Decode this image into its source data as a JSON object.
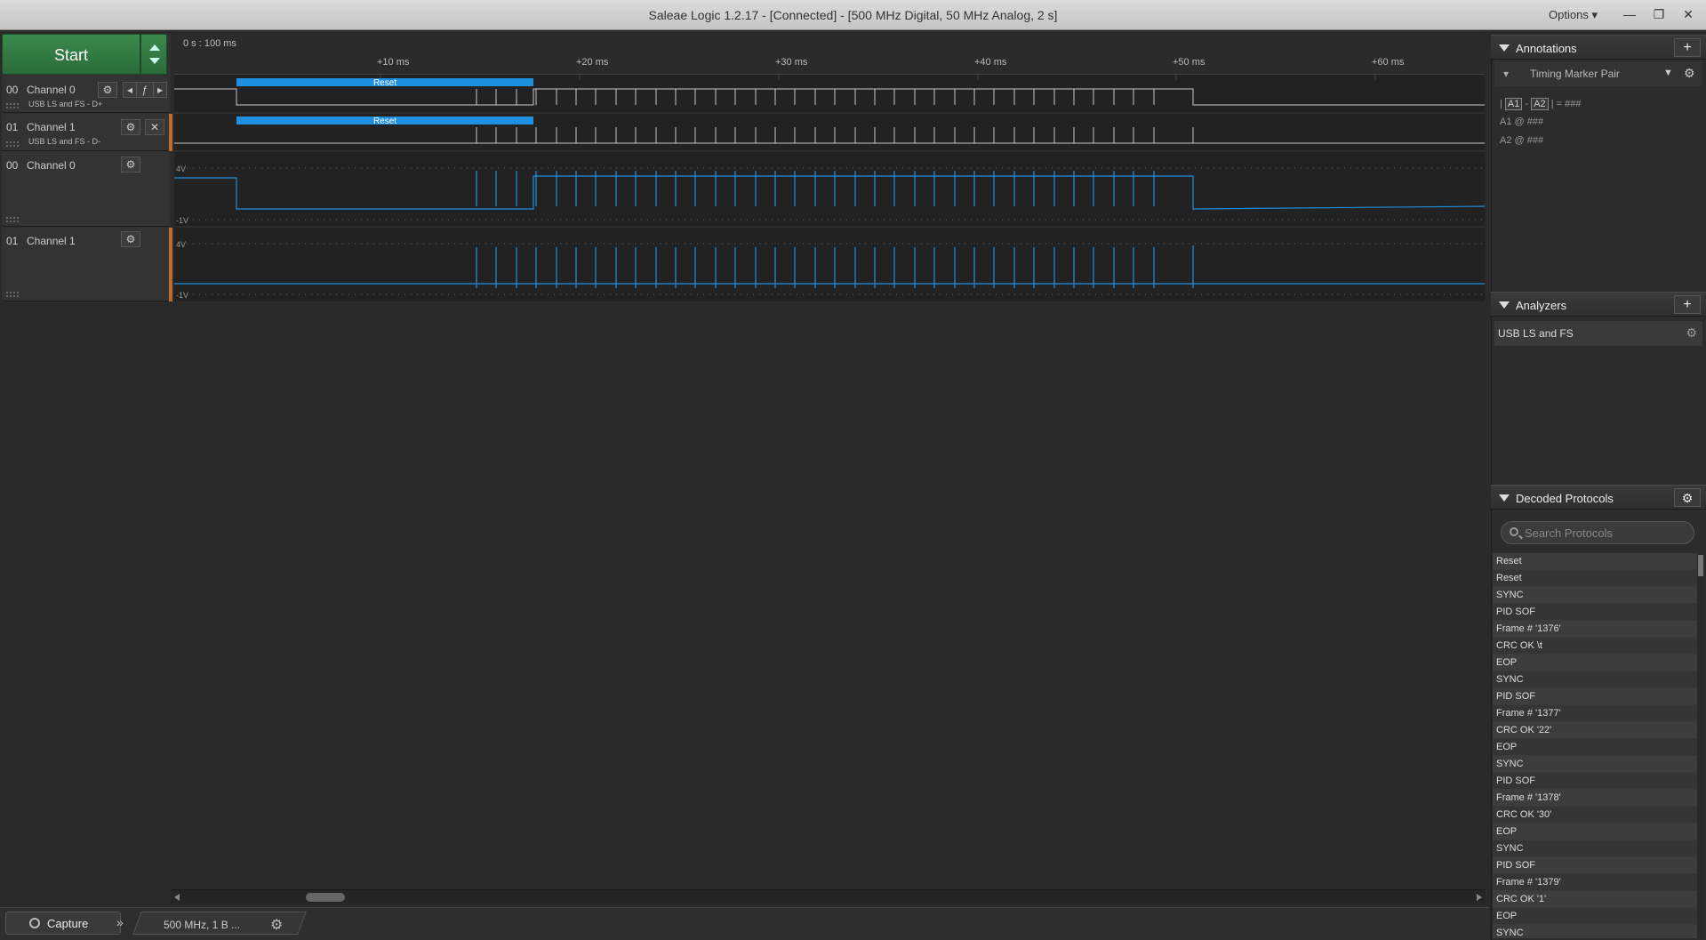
{
  "window": {
    "title": "Saleae Logic 1.2.17 - [Connected] - [500 MHz Digital, 50 MHz Analog, 2 s]",
    "options_label": "Options ▾",
    "minimize": "—",
    "restore": "❐",
    "close": "✕"
  },
  "start": {
    "label": "Start"
  },
  "timeline": {
    "range": "0 s : 100 ms",
    "ticks": [
      "+10 ms",
      "+20 ms",
      "+30 ms",
      "+40 ms",
      "+50 ms",
      "+60 ms"
    ]
  },
  "channels": [
    {
      "num": "00",
      "name": "Channel 0",
      "sub": "USB LS and FS - D+",
      "type": "digital"
    },
    {
      "num": "01",
      "name": "Channel 1",
      "sub": "USB LS and FS - D-",
      "type": "digital"
    },
    {
      "num": "00",
      "name": "Channel 0",
      "type": "analog",
      "vmax": "4V",
      "vmin": "-1V"
    },
    {
      "num": "01",
      "name": "Channel 1",
      "type": "analog",
      "vmax": "4V",
      "vmin": "-1V"
    }
  ],
  "decode_labels": {
    "reset": "Reset"
  },
  "annotations": {
    "title": "Annotations",
    "marker_type": "Timing Marker Pair",
    "a1": "A1",
    "a2": "A2",
    "dash": "-",
    "eq": "= ###",
    "a1_line": "A1 @ ###",
    "a2_line": "A2 @ ###"
  },
  "analyzers": {
    "title": "Analyzers",
    "items": [
      "USB LS and FS"
    ]
  },
  "decoded": {
    "title": "Decoded Protocols",
    "search_placeholder": "Search Protocols",
    "items": [
      "Reset",
      "Reset",
      "SYNC",
      "PID SOF",
      "Frame # '1376'",
      "CRC OK \\t",
      "EOP",
      "SYNC",
      "PID SOF",
      "Frame # '1377'",
      "CRC OK '22'",
      "EOP",
      "SYNC",
      "PID SOF",
      "Frame # '1378'",
      "CRC OK '30'",
      "EOP",
      "SYNC",
      "PID SOF",
      "Frame # '1379'",
      "CRC OK '1'",
      "EOP",
      "SYNC"
    ]
  },
  "bottom": {
    "capture_label": "Capture",
    "session_label": "500 MHz, 1 B ...",
    "more": "»"
  },
  "colors": {
    "accent_blue": "#1f8fe0",
    "start_green": "#2f7a42",
    "orange": "#c06b2a"
  }
}
